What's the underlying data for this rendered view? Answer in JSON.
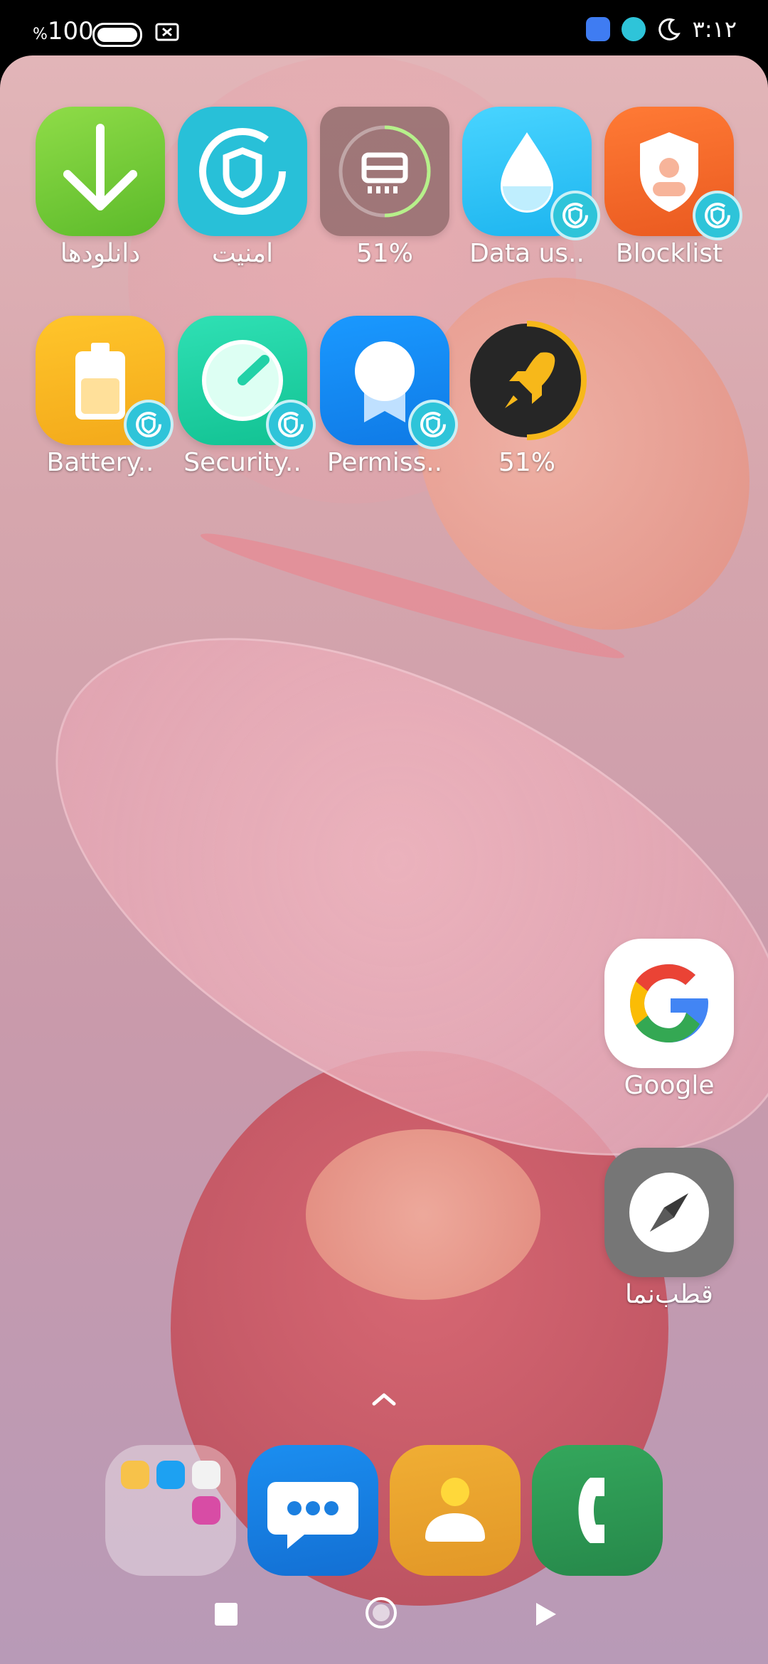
{
  "status_bar": {
    "battery_percent": "100",
    "percent_sign": "%",
    "time": "۳:۱۲",
    "icons": [
      "battery-icon",
      "screenshot-icon",
      "app-notification-icon",
      "security-icon",
      "moon-icon"
    ]
  },
  "home": {
    "row1": [
      {
        "label": "دانلودها",
        "icon": "download-icon",
        "color": "#7ed03a"
      },
      {
        "label": "امنیت",
        "icon": "shield-icon",
        "color": "#28c0d8"
      },
      {
        "label": "51%",
        "icon": "cleaner-icon",
        "color": "#9a7b7a"
      },
      {
        "label": "Data us..",
        "icon": "water-drop-icon",
        "color": "#30c7f5"
      },
      {
        "label": "Blocklist",
        "icon": "blocklist-shield-icon",
        "color": "#f06d2c"
      }
    ],
    "row2": [
      {
        "label": "Battery..",
        "icon": "battery-app-icon",
        "color": "#f5b820"
      },
      {
        "label": "Security..",
        "icon": "security-scan-icon",
        "color": "#22d1a7"
      },
      {
        "label": "Permiss..",
        "icon": "permissions-icon",
        "color": "#1488f1"
      },
      {
        "label": "51%",
        "icon": "rocket-icon",
        "color": "#262626"
      }
    ],
    "google": {
      "label": "Google"
    },
    "compass": {
      "label": "قطب‌نما"
    }
  },
  "dock": {
    "folder": "folder-icon",
    "apps": [
      "messages-icon",
      "contacts-icon",
      "phone-icon"
    ],
    "colors": {
      "messages": "#1a7fe0",
      "contacts": "#e8a32e",
      "phone": "#2d9a52"
    }
  },
  "nav": [
    "recent-apps-button",
    "home-button",
    "back-button"
  ]
}
